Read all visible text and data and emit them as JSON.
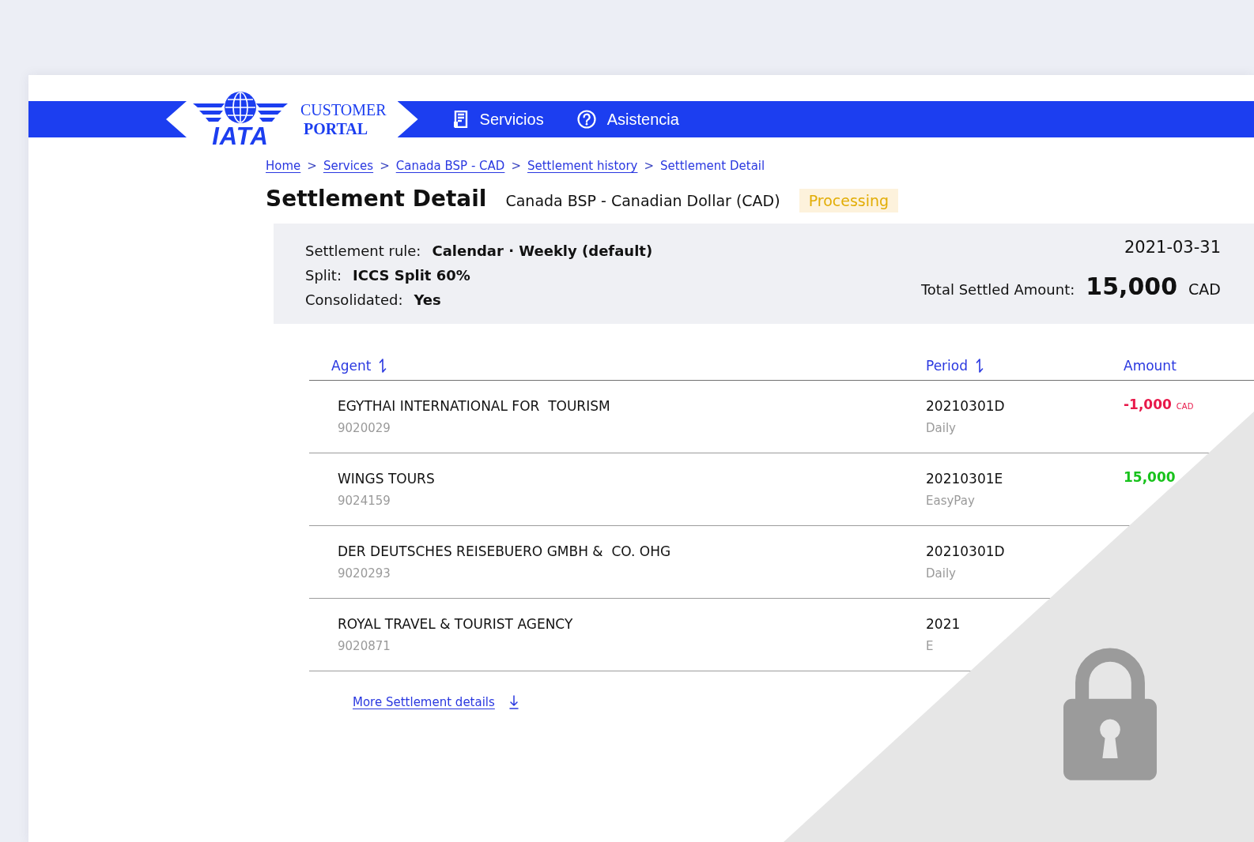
{
  "header": {
    "logo": {
      "wordmark": "IATA",
      "caption_line_1": "CUSTOMER",
      "caption_line_2": "PORTAL"
    },
    "nav": [
      {
        "label": "Servicios"
      },
      {
        "label": "Asistencia"
      }
    ]
  },
  "breadcrumb": [
    {
      "kind": "link",
      "label": "Home"
    },
    {
      "kind": "separator",
      "label": ">"
    },
    {
      "kind": "link",
      "label": "Services"
    },
    {
      "kind": "separator",
      "label": ">"
    },
    {
      "kind": "link",
      "label": "Canada BSP - CAD"
    },
    {
      "kind": "separator",
      "label": ">"
    },
    {
      "kind": "link",
      "label": "Settlement history"
    },
    {
      "kind": "separator",
      "label": ">"
    },
    {
      "kind": "current",
      "label": "Settlement Detail"
    }
  ],
  "title": {
    "heading": "Settlement Detail",
    "subtitle": "Canada BSP - Canadian Dollar (CAD)",
    "status": "Processing"
  },
  "summary": {
    "date": "2021-03-31",
    "details": [
      {
        "label": "Settlement rule:",
        "value": "Calendar · Weekly (default)"
      },
      {
        "label": "Split:",
        "value": "ICCS Split 60%"
      },
      {
        "label": "Consolidated:",
        "value": "Yes"
      }
    ],
    "total": {
      "label": "Total Settled Amount:",
      "value": "15,000",
      "currency": "CAD"
    }
  },
  "table": {
    "columns": [
      {
        "label": "Agent",
        "sortable": true
      },
      {
        "label": "Period",
        "sortable": true
      },
      {
        "label": "Amount",
        "sortable": false
      }
    ],
    "rows": [
      {
        "agent": {
          "name": "EGYTHAI INTERNATIONAL FOR  TOURISM",
          "code": "9020029"
        },
        "period": {
          "code": "20210301D",
          "frequency": "Daily"
        },
        "amount": {
          "value": "-1,000",
          "currency": "CAD",
          "color": "#e8194a"
        }
      },
      {
        "agent": {
          "name": "WINGS TOURS",
          "code": "9024159"
        },
        "period": {
          "code": "20210301E",
          "frequency": "EasyPay"
        },
        "amount": {
          "value": "15,000",
          "color": "#18c21c"
        }
      },
      {
        "agent": {
          "name": "DER DEUTSCHES REISEBUERO GMBH &  CO. OHG",
          "code": "9020293"
        },
        "period": {
          "code": "20210301D",
          "frequency": "Daily"
        }
      },
      {
        "agent": {
          "name": "ROYAL TRAVEL & TOURIST AGENCY",
          "code": "9020871"
        },
        "period": {
          "code": "2021",
          "frequency": "E"
        }
      }
    ]
  },
  "footer_link": {
    "label": "More Settlement details"
  },
  "locked": true
}
